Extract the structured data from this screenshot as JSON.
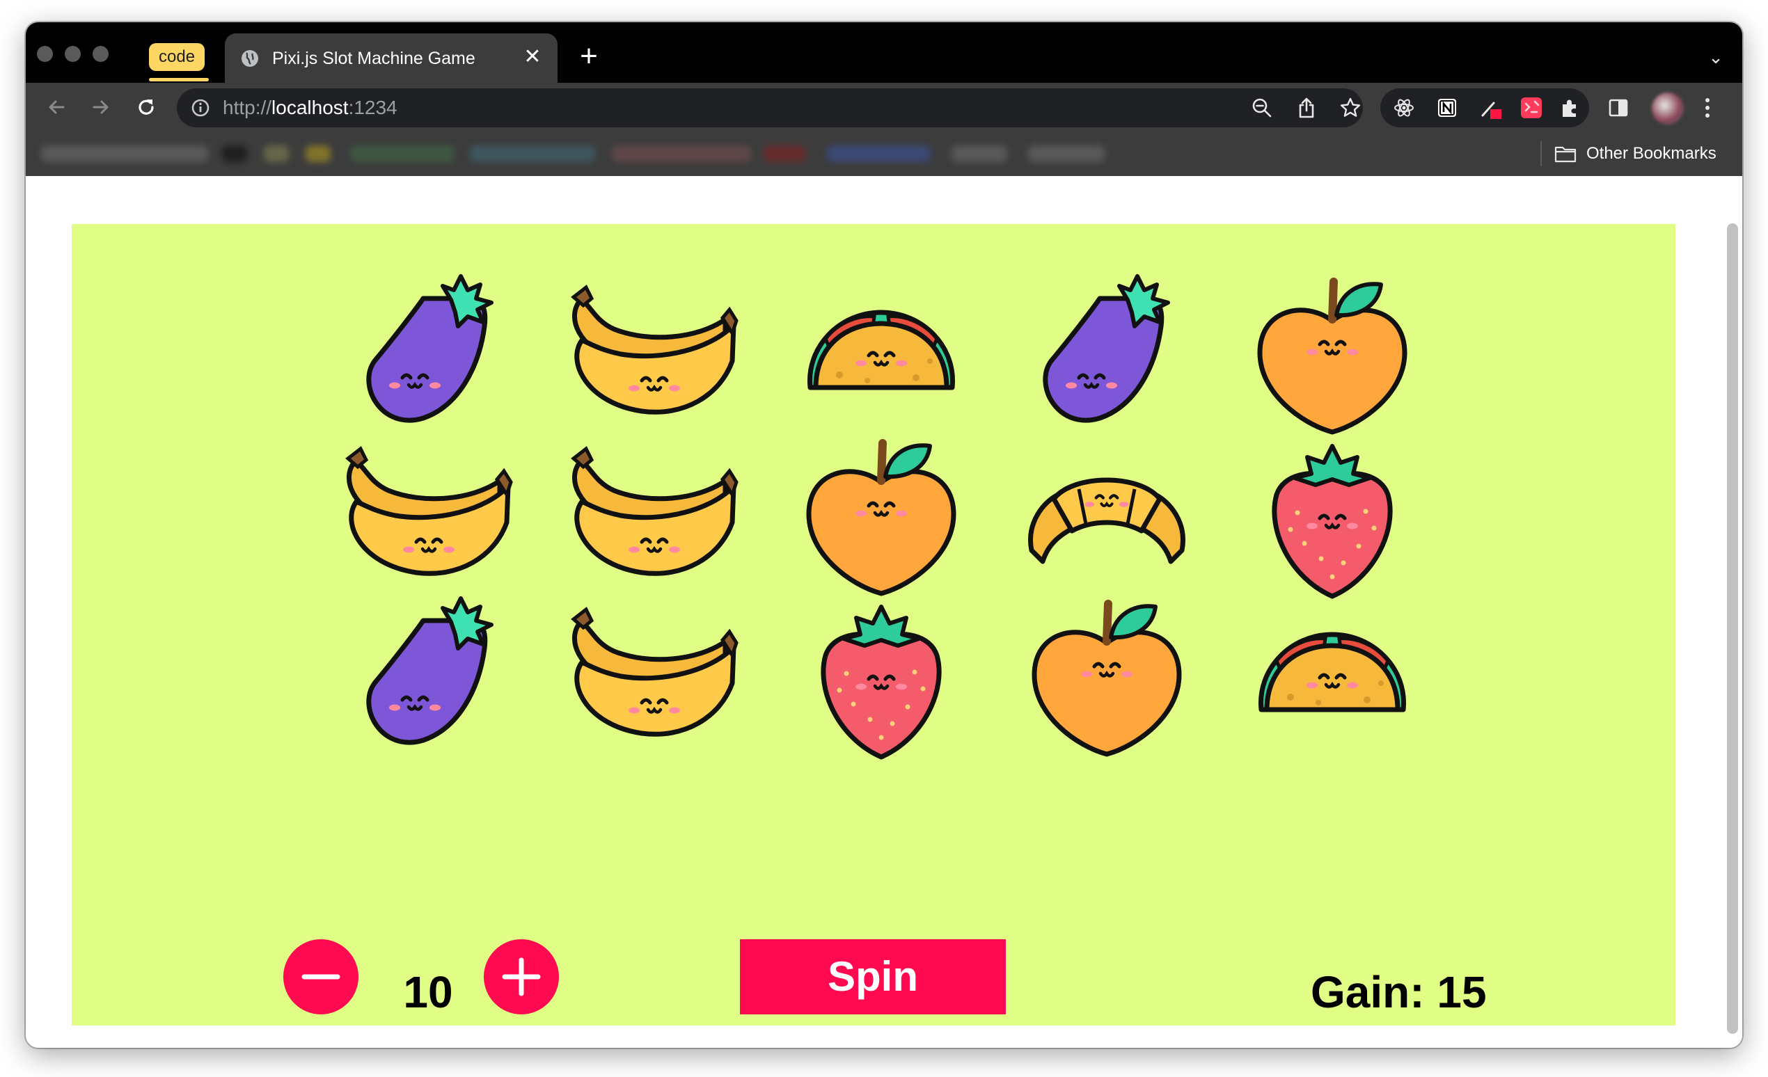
{
  "browser": {
    "tab_group_label": "code",
    "tab_title": "Pixi.js Slot Machine Game",
    "url_scheme": "http://",
    "url_host": "localhost",
    "url_port": ":1234",
    "other_bookmarks_label": "Other Bookmarks",
    "accent_colors": {
      "tab_group": "#fdd663",
      "frame": "#000000",
      "toolbar": "#3c3c3c"
    }
  },
  "game": {
    "background_color": "#e0fd85",
    "button_color": "#ff0a50",
    "reels": [
      [
        "eggplant",
        "banana",
        "eggplant"
      ],
      [
        "banana",
        "banana",
        "banana"
      ],
      [
        "taco",
        "orange",
        "strawberry"
      ],
      [
        "eggplant",
        "croissant",
        "orange"
      ],
      [
        "orange",
        "strawberry",
        "taco"
      ]
    ],
    "bet": "10",
    "spin_label": "Spin",
    "gain_label": "Gain: 15"
  }
}
